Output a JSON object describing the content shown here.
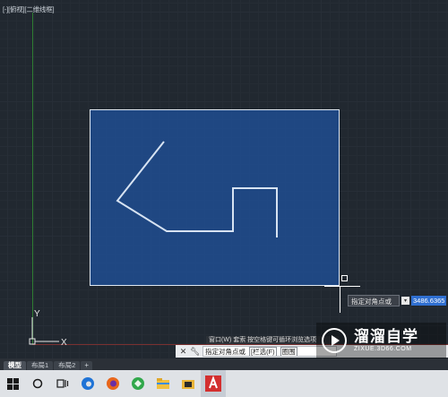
{
  "viewport": {
    "view_label": "[-][俯视][二维线框]"
  },
  "ucs": {
    "x_label": "X",
    "y_label": "Y"
  },
  "dynamic_input": {
    "prompt": "指定对角点或",
    "value": "3486.6365"
  },
  "command_line": {
    "history": "窗口(W) 套索  按空格键可循环浏览选项",
    "prompt": "指定对角点或",
    "option_fence": "[栏选(F)",
    "option_wpolygon": "圈围"
  },
  "watermark": {
    "title": "溜溜自学",
    "subtitle": "ZIXUE.3D66.COM"
  },
  "layout_tabs": [
    {
      "label": "模型"
    },
    {
      "label": "布局1"
    },
    {
      "label": "布局2"
    }
  ],
  "layout_add_label": "+",
  "taskbar": {
    "apps": [
      "windows-start",
      "search",
      "task-view",
      "edge",
      "firefox",
      "app-green",
      "file-explorer",
      "folder-tool",
      "autocad"
    ]
  },
  "colors": {
    "background": "#212830",
    "selection_fill": "#1f529e",
    "accent_red": "#d32f2f"
  }
}
